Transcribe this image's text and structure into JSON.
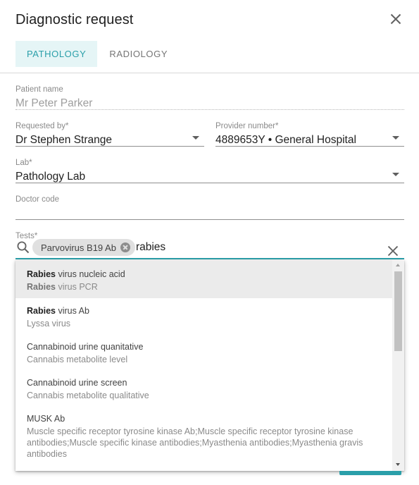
{
  "dialog": {
    "title": "Diagnostic request",
    "close_icon": "close-icon"
  },
  "tabs": [
    {
      "label": "PATHOLOGY",
      "active": true
    },
    {
      "label": "RADIOLOGY",
      "active": false
    }
  ],
  "form": {
    "patient": {
      "label": "Patient name",
      "value": "Mr Peter Parker"
    },
    "requested_by": {
      "label": "Requested by*",
      "value": "Dr Stephen Strange"
    },
    "provider": {
      "label": "Provider number*",
      "value": "4889653Y • General Hospital"
    },
    "lab": {
      "label": "Lab*",
      "value": "Pathology Lab"
    },
    "doctor_code": {
      "label": "Doctor code",
      "value": ""
    },
    "tests": {
      "label": "Tests*",
      "chip": "Parvovirus B19 Ab",
      "typed": "rabies",
      "search_icon": "search-icon",
      "clear_icon": "clear-icon"
    }
  },
  "options": [
    {
      "primary_bold": "Rabies",
      "primary_rest": " virus nucleic acid",
      "secondary_bold": "Rabies",
      "secondary_rest": " virus PCR",
      "highlighted": true
    },
    {
      "primary_bold": "Rabies",
      "primary_rest": " virus Ab",
      "secondary_bold": "",
      "secondary_rest": "Lyssa virus",
      "highlighted": false
    },
    {
      "primary_bold": "",
      "primary_rest": "Cannabinoid urine quanitative",
      "secondary_bold": "",
      "secondary_rest": "Cannabis metabolite level",
      "highlighted": false
    },
    {
      "primary_bold": "",
      "primary_rest": "Cannabinoid urine screen",
      "secondary_bold": "",
      "secondary_rest": "Cannabis metabolite qualitative",
      "highlighted": false
    },
    {
      "primary_bold": "",
      "primary_rest": "MUSK Ab",
      "secondary_bold": "",
      "secondary_rest": "Muscle specific receptor tyrosine kinase Ab;Muscle specific receptor tyrosine kinase antibodies;Muscle specific kinase antibodies;Myasthenia antibodies;Myasthenia gravis antibodies",
      "highlighted": false
    }
  ],
  "colors": {
    "accent": "#2a9fa9",
    "tab_active_bg": "#e5f5f6",
    "highlight_bg": "#ebebeb"
  }
}
